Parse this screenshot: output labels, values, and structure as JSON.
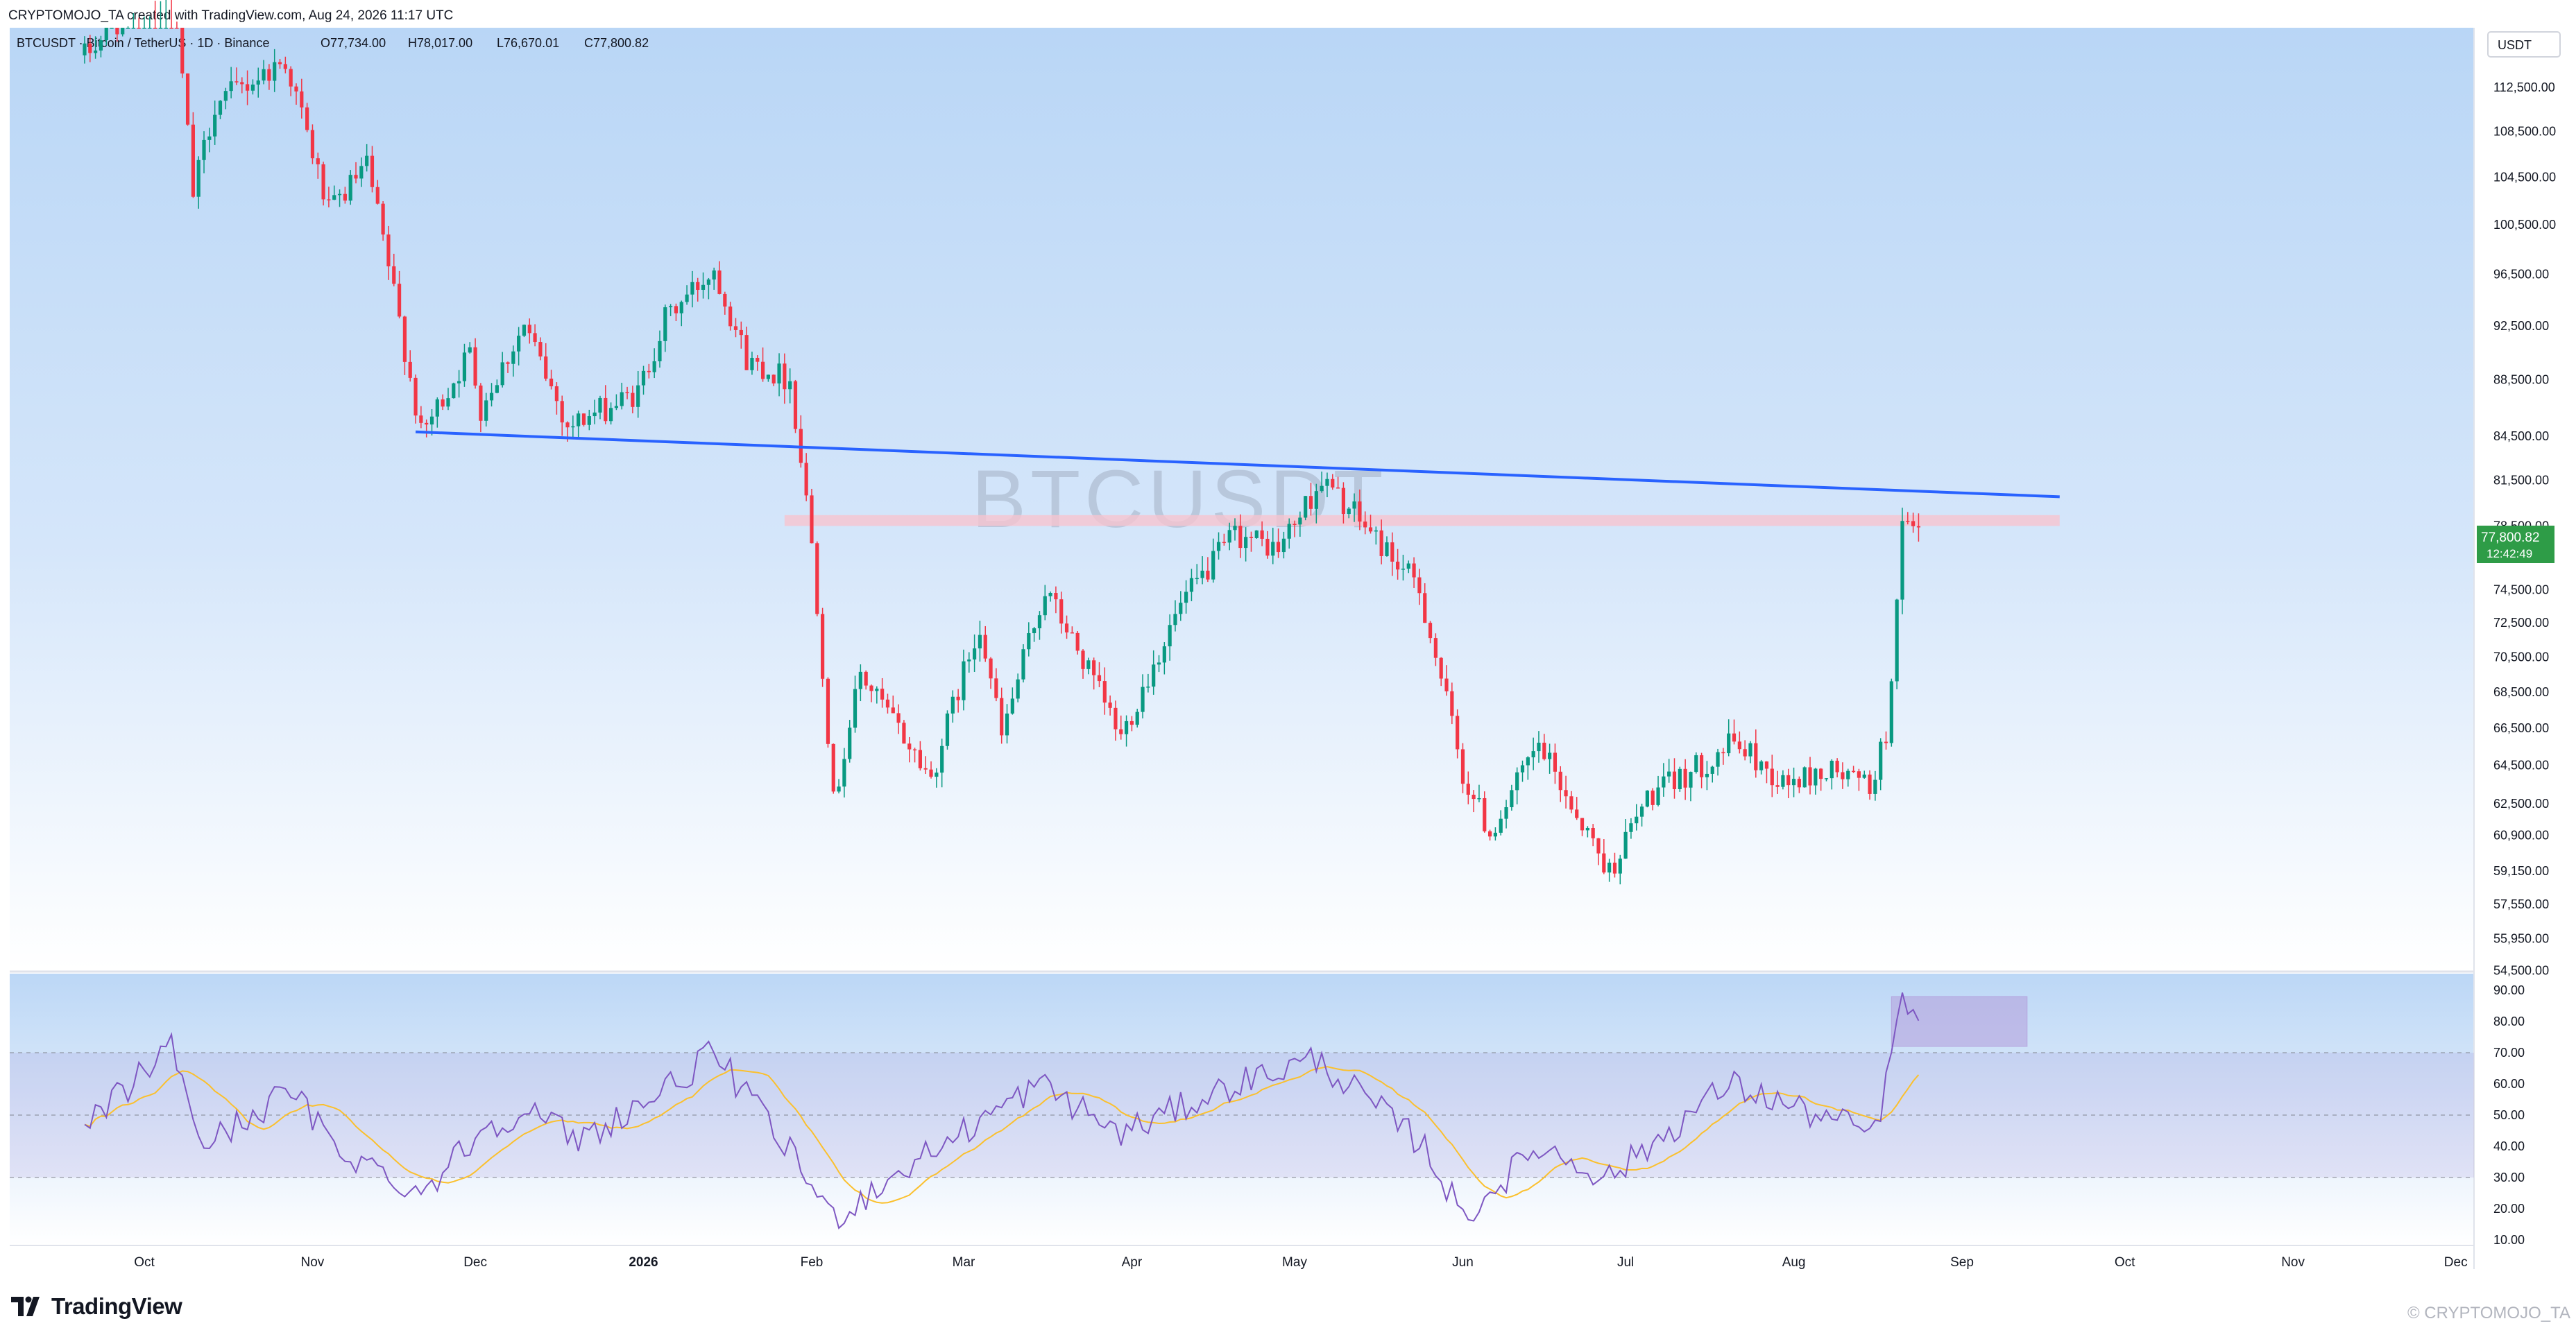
{
  "header": {
    "credit": "CRYPTOMOJO_TA created with TradingView.com, Aug 24, 2026 11:17 UTC",
    "symbol_line": "BTCUSDT · Bitcoin / TetherUS · 1D · Binance",
    "ohlc": {
      "open": "O77,734.00",
      "high": "H78,017.00",
      "low": "L76,670.01",
      "close": "C77,800.82"
    }
  },
  "watermark": "BTCUSDT",
  "author_watermark": "© CRYPTOMOJO_TA",
  "logo_text": "TradingView",
  "price_axis": {
    "currency": "USDT",
    "last_price": "77,800.82",
    "countdown": "12:42:49",
    "ticks": [
      "112,500.00",
      "108,500.00",
      "104,500.00",
      "100,500.00",
      "96,500.00",
      "92,500.00",
      "88,500.00",
      "84,500.00",
      "81,500.00",
      "78,500.00",
      "74,500.00",
      "72,500.00",
      "70,500.00",
      "68,500.00",
      "66,500.00",
      "64,500.00",
      "62,500.00",
      "60,900.00",
      "59,150.00",
      "57,550.00",
      "55,950.00",
      "54,500.00"
    ]
  },
  "rsi_axis": {
    "ticks": [
      "90.00",
      "80.00",
      "70.00",
      "60.00",
      "50.00",
      "40.00",
      "30.00",
      "20.00",
      "10.00"
    ]
  },
  "time_axis": {
    "labels": [
      "Oct",
      "Nov",
      "Dec",
      "2026",
      "Feb",
      "Mar",
      "Apr",
      "May",
      "Jun",
      "Jul",
      "Aug",
      "Sep",
      "Oct",
      "Nov",
      "Dec"
    ]
  },
  "colors": {
    "up": "#089981",
    "down": "#f23645",
    "trendline": "#2962ff",
    "zone": "#f6c4d0",
    "rsi": "#7e57c2",
    "rsi_ma": "#fbc02d",
    "last_price_bg": "#2e9c47"
  },
  "chart_data": {
    "type": "candlestick",
    "symbol": "BTCUSDT",
    "timeframe": "1D",
    "exchange": "Binance",
    "last": {
      "open": 77734.0,
      "high": 78017.0,
      "low": 76670.01,
      "close": 77800.82
    },
    "price_key_points": [
      {
        "date": "2025-09-20",
        "price": 115500
      },
      {
        "date": "2025-10-06",
        "price": 124000
      },
      {
        "date": "2025-10-10",
        "price": 103000
      },
      {
        "date": "2025-10-14",
        "price": 111000
      },
      {
        "date": "2025-10-27",
        "price": 115000
      },
      {
        "date": "2025-11-04",
        "price": 101500
      },
      {
        "date": "2025-11-11",
        "price": 105500
      },
      {
        "date": "2025-11-21",
        "price": 84500
      },
      {
        "date": "2025-11-30",
        "price": 90500
      },
      {
        "date": "2025-12-02",
        "price": 86500
      },
      {
        "date": "2025-12-10",
        "price": 92500
      },
      {
        "date": "2025-12-18",
        "price": 85200
      },
      {
        "date": "2025-12-31",
        "price": 87500
      },
      {
        "date": "2026-01-05",
        "price": 93000
      },
      {
        "date": "2026-01-14",
        "price": 97000
      },
      {
        "date": "2026-01-20",
        "price": 90000
      },
      {
        "date": "2026-01-28",
        "price": 88500
      },
      {
        "date": "2026-02-01",
        "price": 77500
      },
      {
        "date": "2026-02-05",
        "price": 62500
      },
      {
        "date": "2026-02-10",
        "price": 69500
      },
      {
        "date": "2026-02-23",
        "price": 63800
      },
      {
        "date": "2026-03-04",
        "price": 72500
      },
      {
        "date": "2026-03-08",
        "price": 66000
      },
      {
        "date": "2026-03-16",
        "price": 74500
      },
      {
        "date": "2026-03-30",
        "price": 66000
      },
      {
        "date": "2026-04-10",
        "price": 73500
      },
      {
        "date": "2026-04-20",
        "price": 78000
      },
      {
        "date": "2026-04-28",
        "price": 77000
      },
      {
        "date": "2026-05-06",
        "price": 81500
      },
      {
        "date": "2026-05-14",
        "price": 78500
      },
      {
        "date": "2026-05-24",
        "price": 74500
      },
      {
        "date": "2026-06-01",
        "price": 64000
      },
      {
        "date": "2026-06-06",
        "price": 61000
      },
      {
        "date": "2026-06-15",
        "price": 65500
      },
      {
        "date": "2026-06-25",
        "price": 60500
      },
      {
        "date": "2026-06-28",
        "price": 59100
      },
      {
        "date": "2026-07-05",
        "price": 62800
      },
      {
        "date": "2026-07-15",
        "price": 64500
      },
      {
        "date": "2026-07-21",
        "price": 65800
      },
      {
        "date": "2026-07-30",
        "price": 63500
      },
      {
        "date": "2026-08-08",
        "price": 64200
      },
      {
        "date": "2026-08-15",
        "price": 63400
      },
      {
        "date": "2026-08-18",
        "price": 66000
      },
      {
        "date": "2026-08-20",
        "price": 73500
      },
      {
        "date": "2026-08-21",
        "price": 78200
      },
      {
        "date": "2026-08-24",
        "price": 77800
      }
    ],
    "trendline": {
      "from": {
        "date": "2025-11-20",
        "price": 84800
      },
      "to": {
        "date": "2026-09-19",
        "price": 80400
      }
    },
    "resistance_zone": {
      "from": "2026-01-27",
      "to": "2026-09-19",
      "price_low": 78500,
      "price_high": 79200
    },
    "rsi": {
      "length": 14,
      "ylim": [
        5,
        92
      ],
      "upper": 70,
      "middle": 50,
      "lower": 30,
      "key_points": [
        {
          "date": "2025-09-20",
          "value": 46
        },
        {
          "date": "2025-10-06",
          "value": 72
        },
        {
          "date": "2025-10-12",
          "value": 40
        },
        {
          "date": "2025-10-28",
          "value": 58
        },
        {
          "date": "2025-11-05",
          "value": 40
        },
        {
          "date": "2025-11-21",
          "value": 25
        },
        {
          "date": "2025-12-02",
          "value": 45
        },
        {
          "date": "2025-12-10",
          "value": 52
        },
        {
          "date": "2025-12-20",
          "value": 42
        },
        {
          "date": "2026-01-05",
          "value": 58
        },
        {
          "date": "2026-01-14",
          "value": 70
        },
        {
          "date": "2026-01-28",
          "value": 38
        },
        {
          "date": "2026-02-05",
          "value": 17
        },
        {
          "date": "2026-02-20",
          "value": 35
        },
        {
          "date": "2026-03-15",
          "value": 60
        },
        {
          "date": "2026-03-30",
          "value": 44
        },
        {
          "date": "2026-04-20",
          "value": 60
        },
        {
          "date": "2026-05-05",
          "value": 68
        },
        {
          "date": "2026-05-25",
          "value": 40
        },
        {
          "date": "2026-06-01",
          "value": 17
        },
        {
          "date": "2026-06-15",
          "value": 40
        },
        {
          "date": "2026-06-28",
          "value": 30
        },
        {
          "date": "2026-07-20",
          "value": 60
        },
        {
          "date": "2026-08-05",
          "value": 50
        },
        {
          "date": "2026-08-16",
          "value": 44
        },
        {
          "date": "2026-08-20",
          "value": 78
        },
        {
          "date": "2026-08-21",
          "value": 86
        },
        {
          "date": "2026-08-24",
          "value": 81
        }
      ],
      "highlight_box": {
        "from": "2026-08-19",
        "to": "2026-09-13",
        "value_low": 72,
        "value_high": 88
      }
    }
  }
}
